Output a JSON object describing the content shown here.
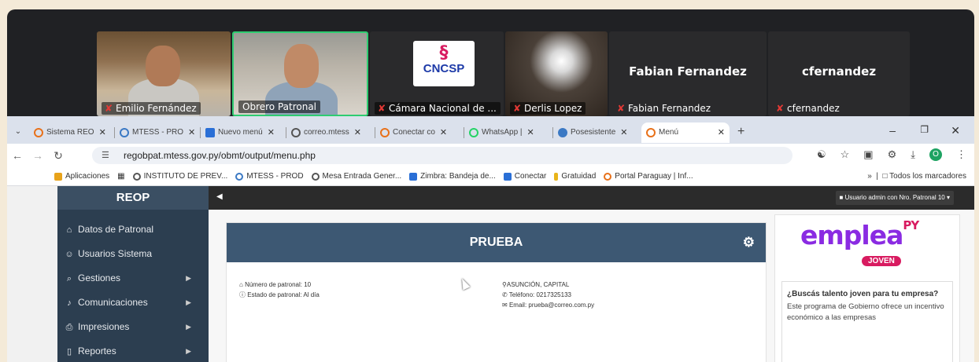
{
  "participants": [
    {
      "name": "Emilio Fernández"
    },
    {
      "name": "Obrero Patronal"
    },
    {
      "name": "Cámara Nacional de ...",
      "logo_text": "CNCSP"
    },
    {
      "name": "Derlis Lopez"
    },
    {
      "name": "Fabian Fernandez",
      "big_name": "Fabian Fernandez"
    },
    {
      "name": "cfernandez",
      "big_name": "cfernandez"
    }
  ],
  "browser": {
    "tabs": [
      {
        "label": "Sistema REO",
        "color": "#e8711a"
      },
      {
        "label": "MTESS - PRO",
        "color": "#3b79c4"
      },
      {
        "label": "Nuevo menú",
        "color": "#2a6fd6"
      },
      {
        "label": "correo.mtess",
        "color": "#555555"
      },
      {
        "label": "Conectar co",
        "color": "#e8711a"
      },
      {
        "label": "WhatsApp |",
        "color": "#25d366"
      },
      {
        "label": "Posesistente",
        "color": "#3b79c4"
      },
      {
        "label": "Menú",
        "color": "#e8711a"
      }
    ],
    "url": "regobpat.mtess.gov.py/obmt/output/menu.php",
    "bookmarks": [
      {
        "label": "Aplicaciones",
        "color": "#e8a31a"
      },
      {
        "label": "INSTITUTO DE PREV...",
        "color": "#555555"
      },
      {
        "label": "MTESS - PROD",
        "color": "#3b79c4"
      },
      {
        "label": "Mesa Entrada Gener...",
        "color": "#555555"
      },
      {
        "label": "Zimbra: Bandeja de...",
        "color": "#2a6fd6"
      },
      {
        "label": "Conectar",
        "color": "#2a6fd6"
      },
      {
        "label": "Gratuidad",
        "color": "#e8b41a"
      },
      {
        "label": "Portal Paraguay | Inf...",
        "color": "#e8711a"
      }
    ],
    "bookmarks_more": "Todos los marcadores",
    "profile_initial": "O"
  },
  "app": {
    "brand": "REOP",
    "menu": [
      {
        "label": "Datos de Patronal",
        "icon": "home-icon",
        "glyph": "⌂",
        "arrow": false
      },
      {
        "label": "Usuarios Sistema",
        "icon": "users-icon",
        "glyph": "☺",
        "arrow": false
      },
      {
        "label": "Gestiones",
        "icon": "search-icon",
        "glyph": "⌕",
        "arrow": true
      },
      {
        "label": "Comunicaciones",
        "icon": "bell-icon",
        "glyph": "♪",
        "arrow": true
      },
      {
        "label": "Impresiones",
        "icon": "print-icon",
        "glyph": "⎙",
        "arrow": true
      },
      {
        "label": "Reportes",
        "icon": "file-icon",
        "glyph": "▯",
        "arrow": true
      }
    ],
    "user_button": "Usuario admin con Nro. Patronal 10",
    "panel_title": "PRUEBA",
    "info": {
      "numero_patronal": "Número de patronal: 10",
      "estado_patronal": "Estado de patronal: Al día",
      "ubicacion": "ASUNCIÓN, CAPITAL",
      "telefono": "Teléfono: 0217325133",
      "email": "Email: prueba@correo.com.py"
    },
    "ad": {
      "logo": "emplea",
      "logo_sup": "PY",
      "badge": "JOVEN",
      "title": "¿Buscás talento joven para tu empresa?",
      "text": "Este programa de Gobierno ofrece un incentivo económico a las empresas"
    }
  }
}
